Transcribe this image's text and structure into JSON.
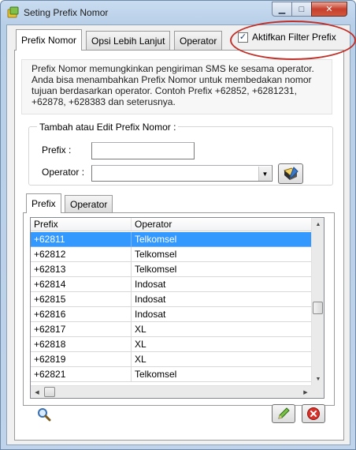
{
  "window": {
    "title": "Seting Prefix Nomor",
    "minimize_icon": "minimize-icon",
    "maximize_icon": "maximize-icon",
    "close_icon": "close-icon"
  },
  "tabs": [
    {
      "label": "Prefix Nomor",
      "active": true
    },
    {
      "label": "Opsi Lebih Lanjut",
      "active": false
    },
    {
      "label": "Operator",
      "active": false
    }
  ],
  "filter": {
    "label": "Aktifkan Filter Prefix",
    "checked": true
  },
  "info": {
    "line1": "Prefix Nomor memungkinkan pengiriman SMS ke sesama operator.",
    "line2": "Anda bisa menambahkan Prefix Nomor untuk membedakan nomor",
    "line3": "tujuan berdasarkan operator. Contoh Prefix +62852, +6281231,",
    "line4": "+62878, +628383 dan seterusnya."
  },
  "form": {
    "legend": "Tambah atau Edit Prefix Nomor :",
    "prefix_label": "Prefix :",
    "prefix_value": "",
    "operator_label": "Operator :",
    "operator_value": ""
  },
  "inner_tabs": [
    {
      "label": "Prefix",
      "active": true
    },
    {
      "label": "Operator",
      "active": false
    }
  ],
  "table": {
    "columns": [
      "Prefix",
      "Operator"
    ],
    "rows": [
      {
        "prefix": "+62811",
        "operator": "Telkomsel"
      },
      {
        "prefix": "+62812",
        "operator": "Telkomsel"
      },
      {
        "prefix": "+62813",
        "operator": "Telkomsel"
      },
      {
        "prefix": "+62814",
        "operator": "Indosat"
      },
      {
        "prefix": "+62815",
        "operator": "Indosat"
      },
      {
        "prefix": "+62816",
        "operator": "Indosat"
      },
      {
        "prefix": "+62817",
        "operator": "XL"
      },
      {
        "prefix": "+62818",
        "operator": "XL"
      },
      {
        "prefix": "+62819",
        "operator": "XL"
      },
      {
        "prefix": "+62821",
        "operator": "Telkomsel"
      }
    ],
    "selected_index": 0
  },
  "colors": {
    "selection": "#3399ff",
    "annotation_ellipse": "#c0312a"
  }
}
